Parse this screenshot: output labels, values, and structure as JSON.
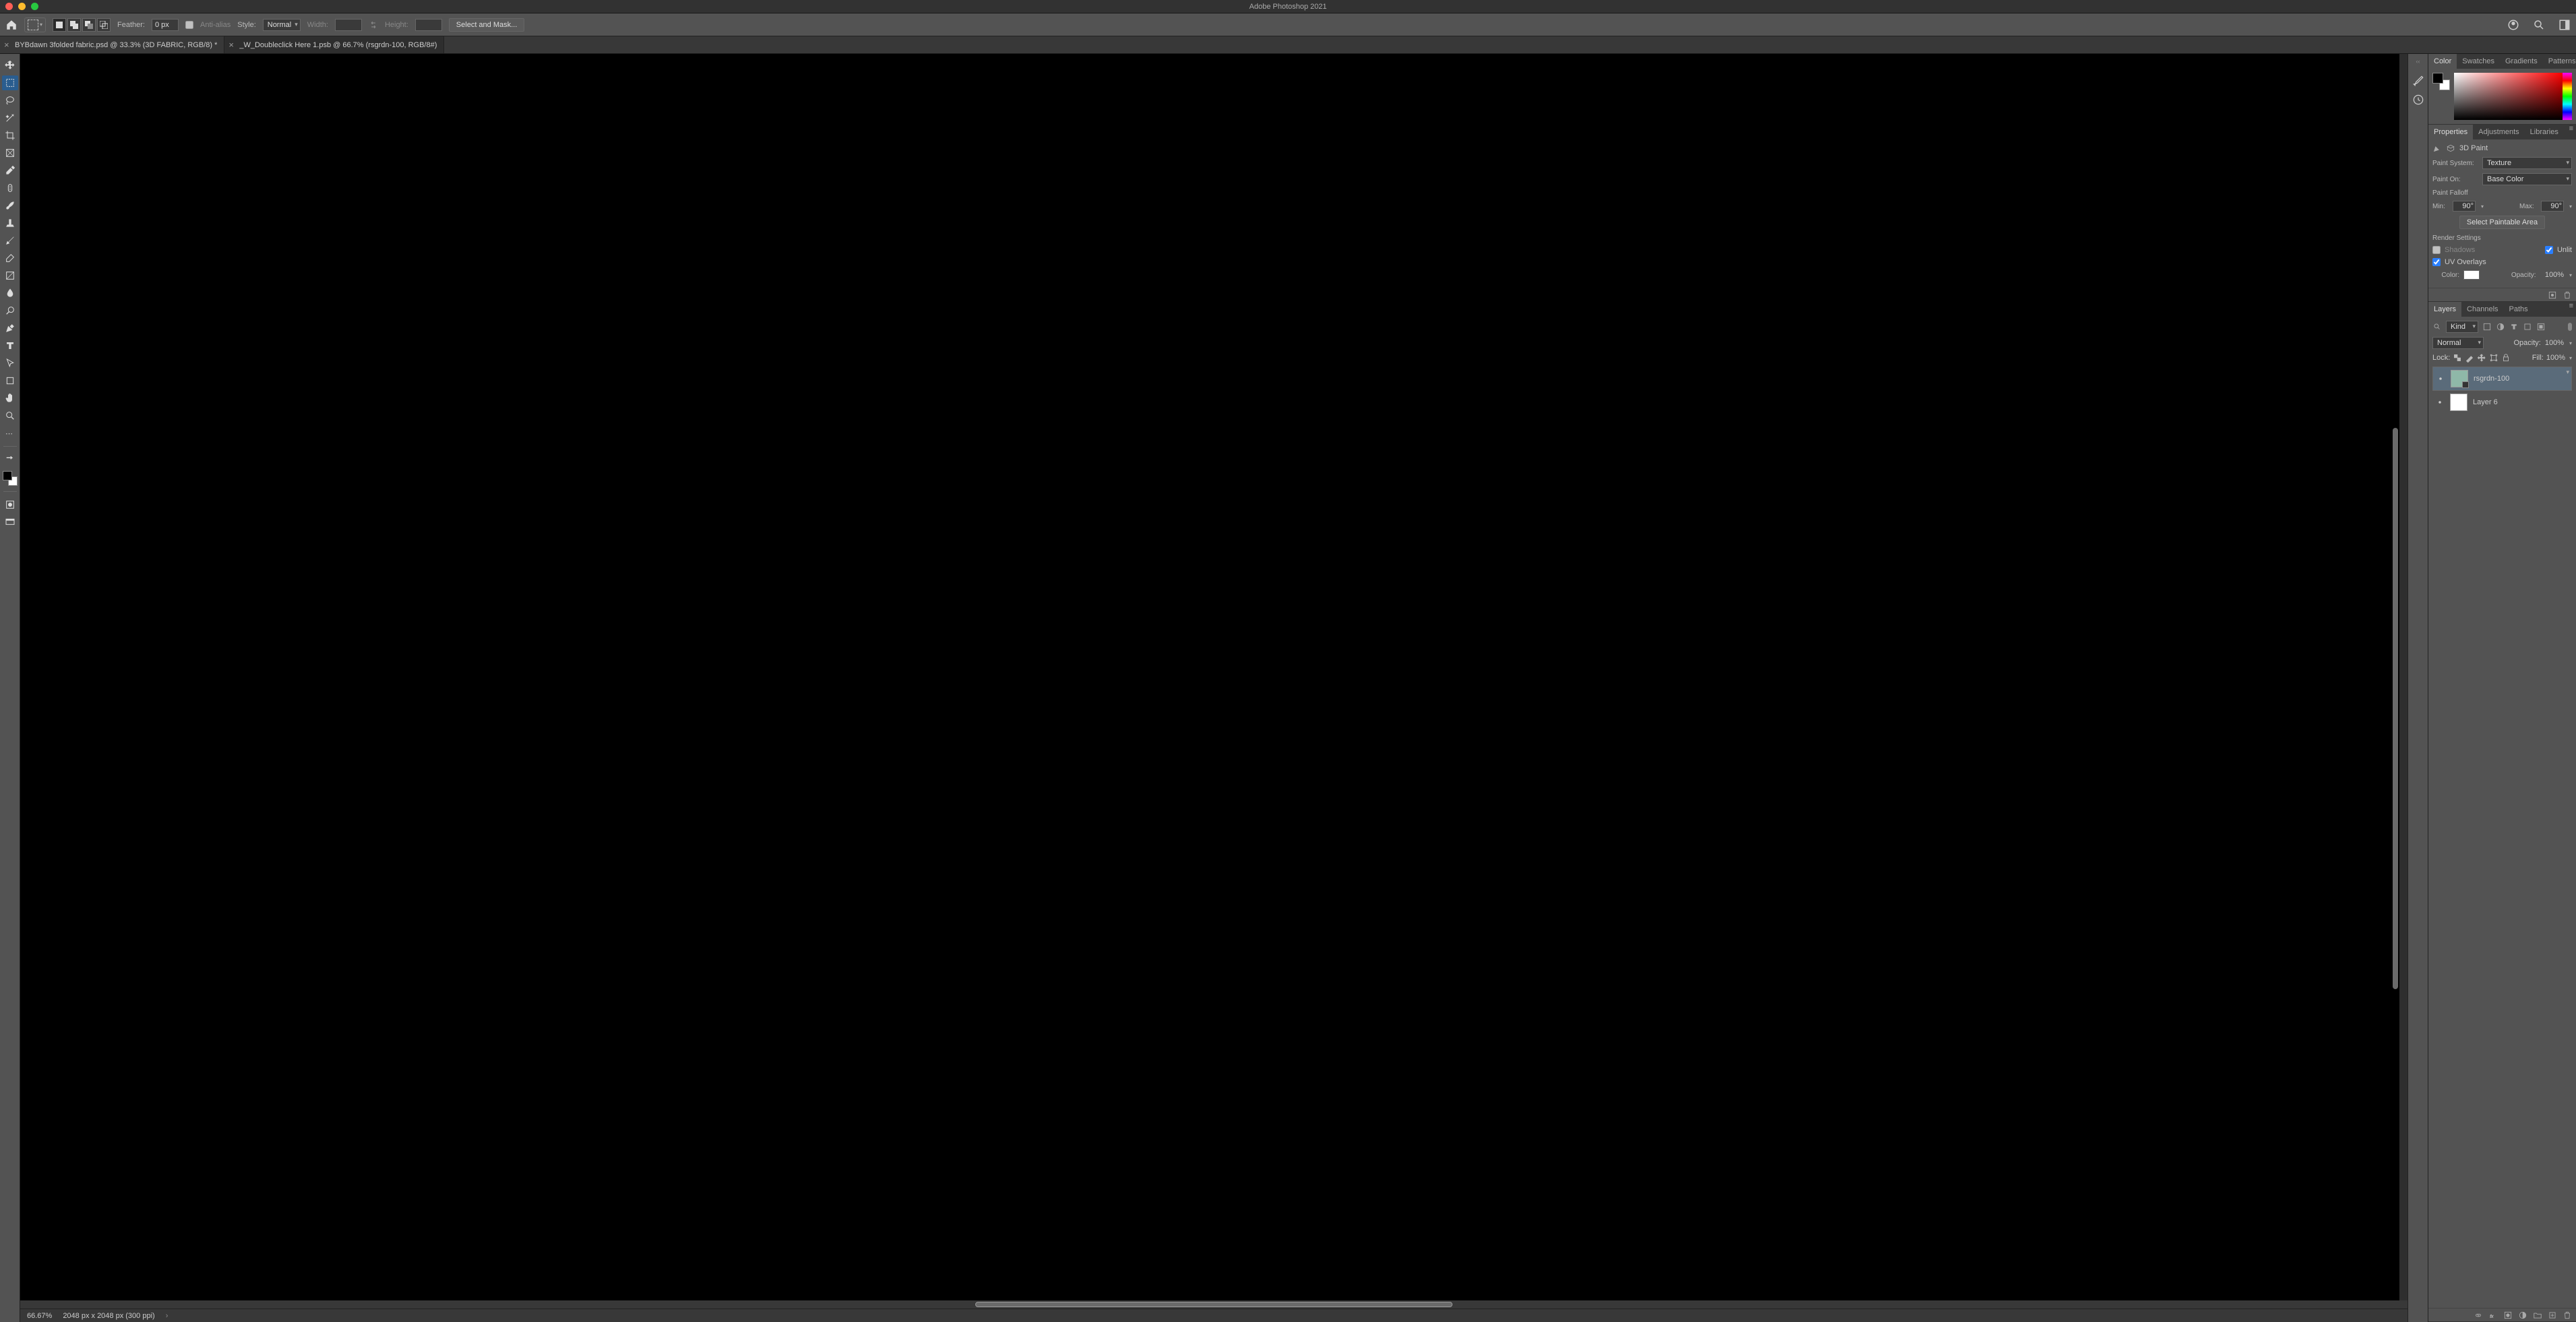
{
  "app": {
    "title": "Adobe Photoshop 2021"
  },
  "optbar": {
    "feather_label": "Feather:",
    "feather_value": "0 px",
    "antialias_label": "Anti-alias",
    "style_label": "Style:",
    "style_value": "Normal",
    "width_label": "Width:",
    "height_label": "Height:",
    "select_mask": "Select and Mask..."
  },
  "tabs": [
    {
      "label": "BYBdawn 3folded fabric.psd @ 33.3% (3D FABRIC, RGB/8) *",
      "active": false
    },
    {
      "label": "_W_Doubleclick Here 1.psb @ 66.7% (rsgrdn-100, RGB/8#)",
      "active": true
    }
  ],
  "status": {
    "zoom": "66.67%",
    "dims": "2048 px x 2048 px (300 ppi)"
  },
  "color_panel": {
    "tabs": [
      "Color",
      "Swatches",
      "Gradients",
      "Patterns"
    ],
    "active": "Color"
  },
  "props_panel": {
    "tabs": [
      "Properties",
      "Adjustments",
      "Libraries"
    ],
    "active": "Properties",
    "title": "3D Paint",
    "paint_system_label": "Paint System:",
    "paint_system_value": "Texture",
    "paint_on_label": "Paint On:",
    "paint_on_value": "Base Color",
    "falloff_label": "Paint Falloff",
    "min_label": "Min:",
    "min_value": "90°",
    "max_label": "Max:",
    "max_value": "90°",
    "select_paintable": "Select Paintable Area",
    "render_label": "Render Settings",
    "shadows_label": "Shadows",
    "unlit_label": "Unlit",
    "uv_label": "UV Overlays",
    "color_label": "Color:",
    "opacity_label": "Opacity:",
    "opacity_value": "100%"
  },
  "layers_panel": {
    "tabs": [
      "Layers",
      "Channels",
      "Paths"
    ],
    "active": "Layers",
    "filter_label": "Kind",
    "blend_value": "Normal",
    "opacity_label": "Opacity:",
    "opacity_value": "100%",
    "lock_label": "Lock:",
    "fill_label": "Fill:",
    "fill_value": "100%",
    "layers": [
      {
        "name": "rsgrdn-100",
        "selected": true,
        "smart": true
      },
      {
        "name": "Layer 6",
        "selected": false,
        "smart": false
      }
    ]
  }
}
